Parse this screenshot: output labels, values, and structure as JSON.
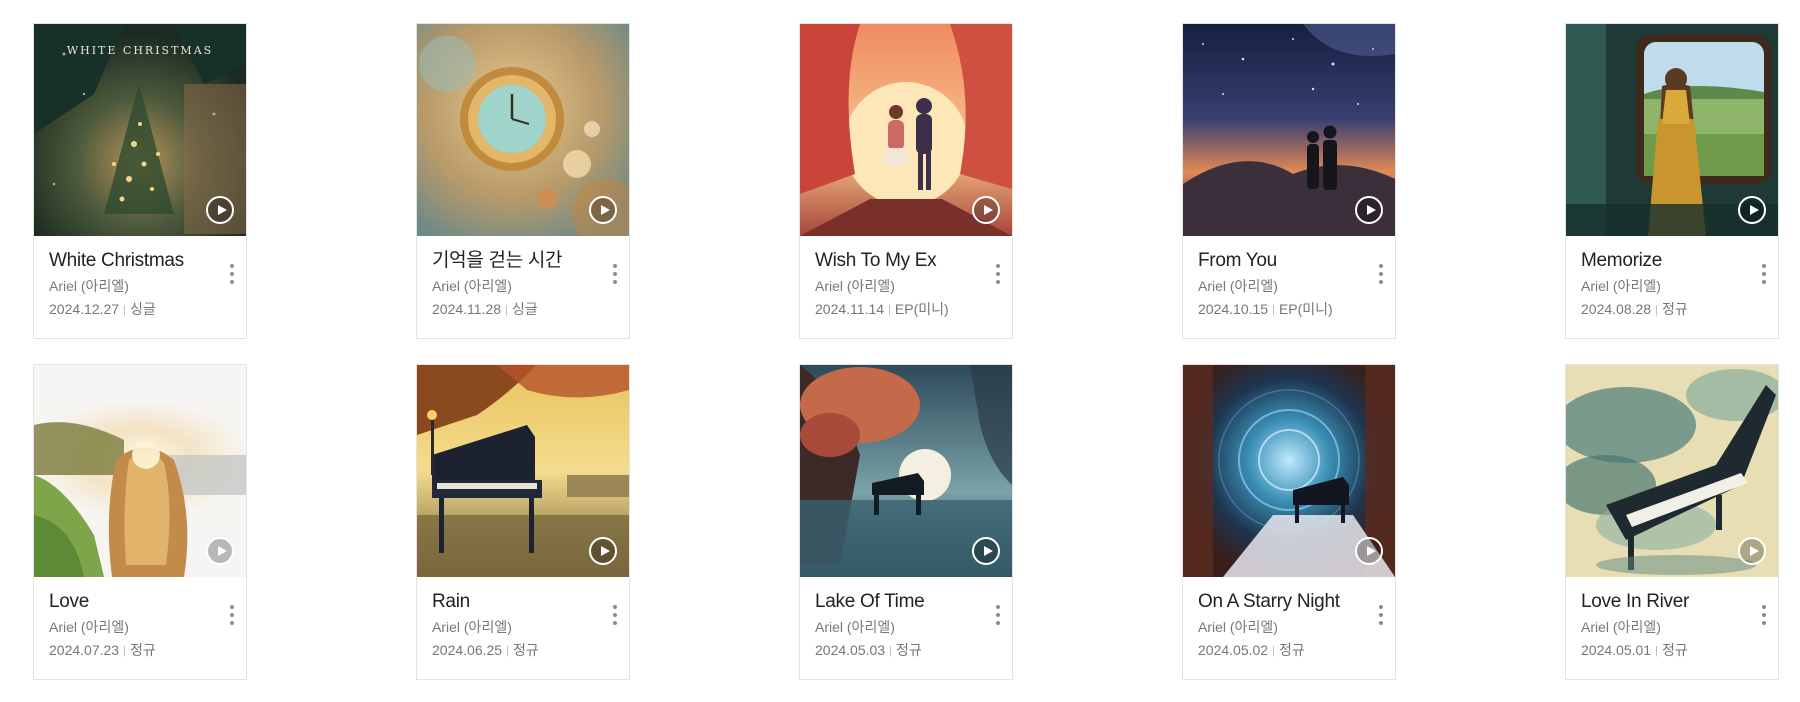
{
  "albums": [
    {
      "title": "White Christmas",
      "artist": "Ariel (아리엘)",
      "date": "2024.12.27",
      "type": "싱글",
      "art": "christmas",
      "cover_text": "WHITE CHRISTMAS"
    },
    {
      "title": "기억을 걷는 시간",
      "artist": "Ariel (아리엘)",
      "date": "2024.11.28",
      "type": "싱글",
      "art": "clock"
    },
    {
      "title": "Wish To My Ex",
      "artist": "Ariel (아리엘)",
      "date": "2024.11.14",
      "type": "EP(미니)",
      "art": "sunset-couple"
    },
    {
      "title": "From You",
      "artist": "Ariel (아리엘)",
      "date": "2024.10.15",
      "type": "EP(미니)",
      "art": "starry-couple"
    },
    {
      "title": "Memorize",
      "artist": "Ariel (아리엘)",
      "date": "2024.08.28",
      "type": "정규",
      "art": "train-window"
    },
    {
      "title": "Love",
      "artist": "Ariel (아리엘)",
      "date": "2024.07.23",
      "type": "정규",
      "art": "sunlight-hair"
    },
    {
      "title": "Rain",
      "artist": "Ariel (아리엘)",
      "date": "2024.06.25",
      "type": "정규",
      "art": "piano-harbor"
    },
    {
      "title": "Lake Of Time",
      "artist": "Ariel (아리엘)",
      "date": "2024.05.03",
      "type": "정규",
      "art": "lake-piano"
    },
    {
      "title": "On A Starry Night",
      "artist": "Ariel (아리엘)",
      "date": "2024.05.02",
      "type": "정규",
      "art": "cosmic-piano"
    },
    {
      "title": "Love In River",
      "artist": "Ariel (아리엘)",
      "date": "2024.05.01",
      "type": "정규",
      "art": "smoke-piano"
    }
  ]
}
